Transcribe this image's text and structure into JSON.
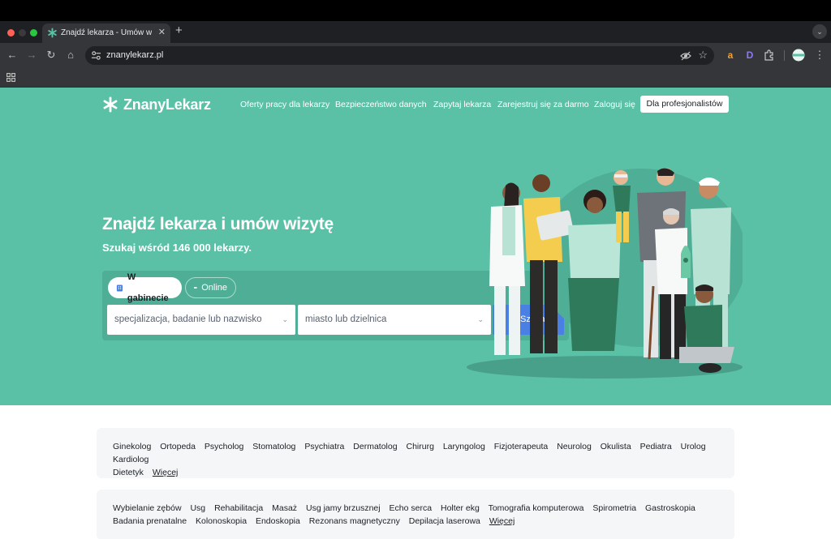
{
  "browser": {
    "tab_title": "Znajdź lekarza - Umów wizytę",
    "url": "znanylekarz.pl",
    "extensions": [
      "a",
      "D"
    ]
  },
  "site": {
    "logo": "ZnanyLekarz",
    "nav": [
      "Oferty pracy dla lekarzy",
      "Bezpieczeństwo danych",
      "Zapytaj lekarza",
      "Zarejestruj się za darmo",
      "Zaloguj się"
    ],
    "pro_button": "Dla profesjonalistów",
    "brand_color": "#5bc1a6",
    "button_color": "#4a7fe3"
  },
  "hero": {
    "title": "Znajdź lekarza i umów wizytę",
    "subtitle": "Szukaj wśród 146 000 lekarzy."
  },
  "search": {
    "tab_office": "W gabinecie",
    "tab_online": "Online",
    "specialty_placeholder": "specjalizacja, badanie lub nazwisko",
    "city_placeholder": "miasto lub dzielnica",
    "submit": "Szukaj"
  },
  "specialties": {
    "items": [
      "Ginekolog",
      "Ortopeda",
      "Psycholog",
      "Stomatolog",
      "Psychiatra",
      "Dermatolog",
      "Chirurg",
      "Laryngolog",
      "Fizjoterapeuta",
      "Neurolog",
      "Okulista",
      "Pediatra",
      "Urolog",
      "Kardiolog",
      "Dietetyk"
    ],
    "more": "Więcej"
  },
  "services": {
    "items": [
      "Wybielanie zębów",
      "Usg",
      "Rehabilitacja",
      "Masaż",
      "Usg jamy brzusznej",
      "Echo serca",
      "Holter ekg",
      "Tomografia komputerowa",
      "Spirometria",
      "Gastroskopia",
      "Badania prenatalne",
      "Kolonoskopia",
      "Endoskopia",
      "Rezonans magnetyczny",
      "Depilacja laserowa"
    ],
    "more": "Więcej"
  }
}
